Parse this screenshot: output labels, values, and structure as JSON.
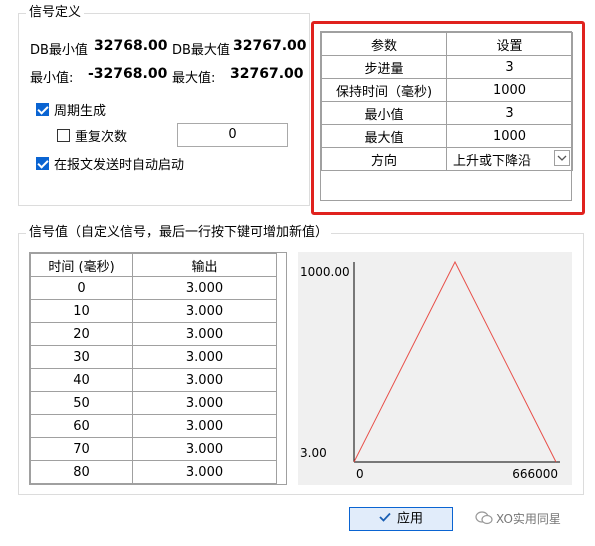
{
  "signal_def": {
    "legend": "信号定义",
    "db_min_label": "DB最小值",
    "db_min_value": "32768.00",
    "db_max_label": "DB最大值",
    "db_max_value": "32767.00",
    "min_label": "最小值:",
    "min_value": "-32768.00",
    "max_label": "最大值:",
    "max_value": "32767.00",
    "periodic_label": "周期生成",
    "periodic_checked": true,
    "repeat_label": "重复次数",
    "repeat_checked": false,
    "repeat_value": "0",
    "autostart_label": "在报文发送时自动启动",
    "autostart_checked": true
  },
  "params": {
    "headers": [
      "参数",
      "设置"
    ],
    "rows": [
      [
        "步进量",
        "3"
      ],
      [
        "保持时间（毫秒)",
        "1000"
      ],
      [
        "最小值",
        "3"
      ],
      [
        "最大值",
        "1000"
      ],
      [
        "方向",
        "上升或下降沿"
      ]
    ]
  },
  "signal_values": {
    "legend": "信号值（自定义信号，最后一行按下键可增加新值）",
    "headers": [
      "时间 (毫秒)",
      "输出"
    ],
    "rows": [
      [
        "0",
        "3.000"
      ],
      [
        "10",
        "3.000"
      ],
      [
        "20",
        "3.000"
      ],
      [
        "30",
        "3.000"
      ],
      [
        "40",
        "3.000"
      ],
      [
        "50",
        "3.000"
      ],
      [
        "60",
        "3.000"
      ],
      [
        "70",
        "3.000"
      ],
      [
        "80",
        "3.000"
      ]
    ]
  },
  "chart_data": {
    "type": "line",
    "x": [
      0,
      333000,
      666000
    ],
    "y": [
      3,
      1000,
      3
    ],
    "xlim": [
      0,
      666000
    ],
    "ylim": [
      3,
      1000
    ],
    "x_tick_labels": [
      "0",
      "666000"
    ],
    "y_tick_labels": [
      "1000.00",
      "3.00"
    ],
    "line_color": "#e8504a",
    "grid": false
  },
  "apply_label": "应用",
  "watermark": "XO实用同星"
}
